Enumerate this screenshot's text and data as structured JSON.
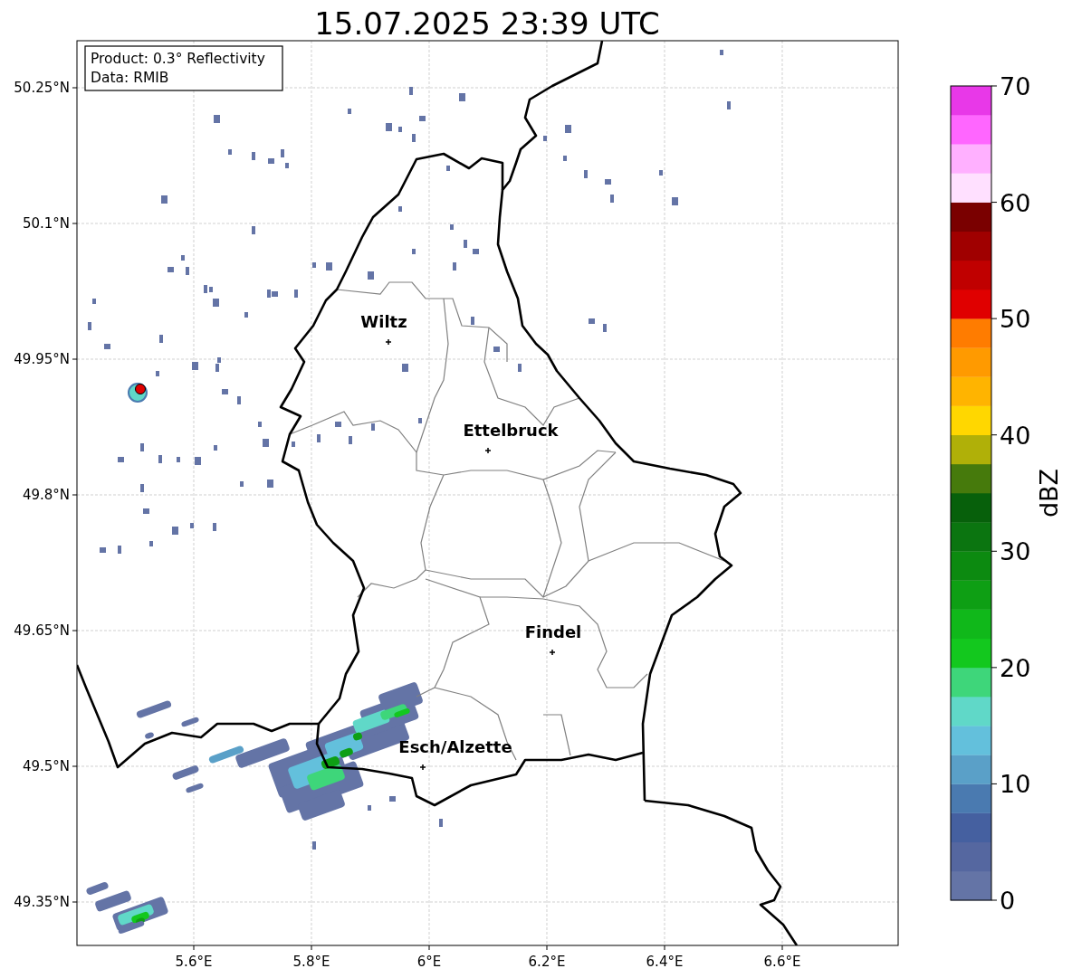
{
  "title": "15.07.2025 23:39 UTC",
  "info_box": {
    "product": "Product: 0.3° Reflectivity",
    "data": "Data: RMIB"
  },
  "map": {
    "yticks": [
      "50.25°N",
      "50.1°N",
      "49.95°N",
      "49.8°N",
      "49.65°N",
      "49.5°N",
      "49.35°N"
    ],
    "xticks": [
      "5.6°E",
      "5.8°E",
      "6°E",
      "6.2°E",
      "6.4°E",
      "6.6°E"
    ],
    "cities": [
      {
        "name": "Wiltz"
      },
      {
        "name": "Ettelbruck"
      },
      {
        "name": "Findel"
      },
      {
        "name": "Esch/Alzette"
      }
    ]
  },
  "colorbar": {
    "label": "dBZ",
    "ticks": [
      "70",
      "60",
      "50",
      "40",
      "30",
      "20",
      "10",
      "0"
    ],
    "bins": [
      {
        "color": "#6474a6"
      },
      {
        "color": "#5567a0"
      },
      {
        "color": "#4560a0"
      },
      {
        "color": "#4a7ab0"
      },
      {
        "color": "#5aa0c8"
      },
      {
        "color": "#63c0dc"
      },
      {
        "color": "#60d8c8"
      },
      {
        "color": "#3ed67a"
      },
      {
        "color": "#13c81e"
      },
      {
        "color": "#10b81a"
      },
      {
        "color": "#0e9f14"
      },
      {
        "color": "#0c8a10"
      },
      {
        "color": "#0b7510"
      },
      {
        "color": "#07600b"
      },
      {
        "color": "#467a0c"
      },
      {
        "color": "#b0b008"
      },
      {
        "color": "#ffd700"
      },
      {
        "color": "#ffb400"
      },
      {
        "color": "#ff9a00"
      },
      {
        "color": "#ff7c00"
      },
      {
        "color": "#e00000"
      },
      {
        "color": "#c00000"
      },
      {
        "color": "#a00000"
      },
      {
        "color": "#7a0000"
      },
      {
        "color": "#ffe0ff"
      },
      {
        "color": "#ffb0ff"
      },
      {
        "color": "#ff66ff"
      },
      {
        "color": "#e838e8"
      }
    ]
  }
}
